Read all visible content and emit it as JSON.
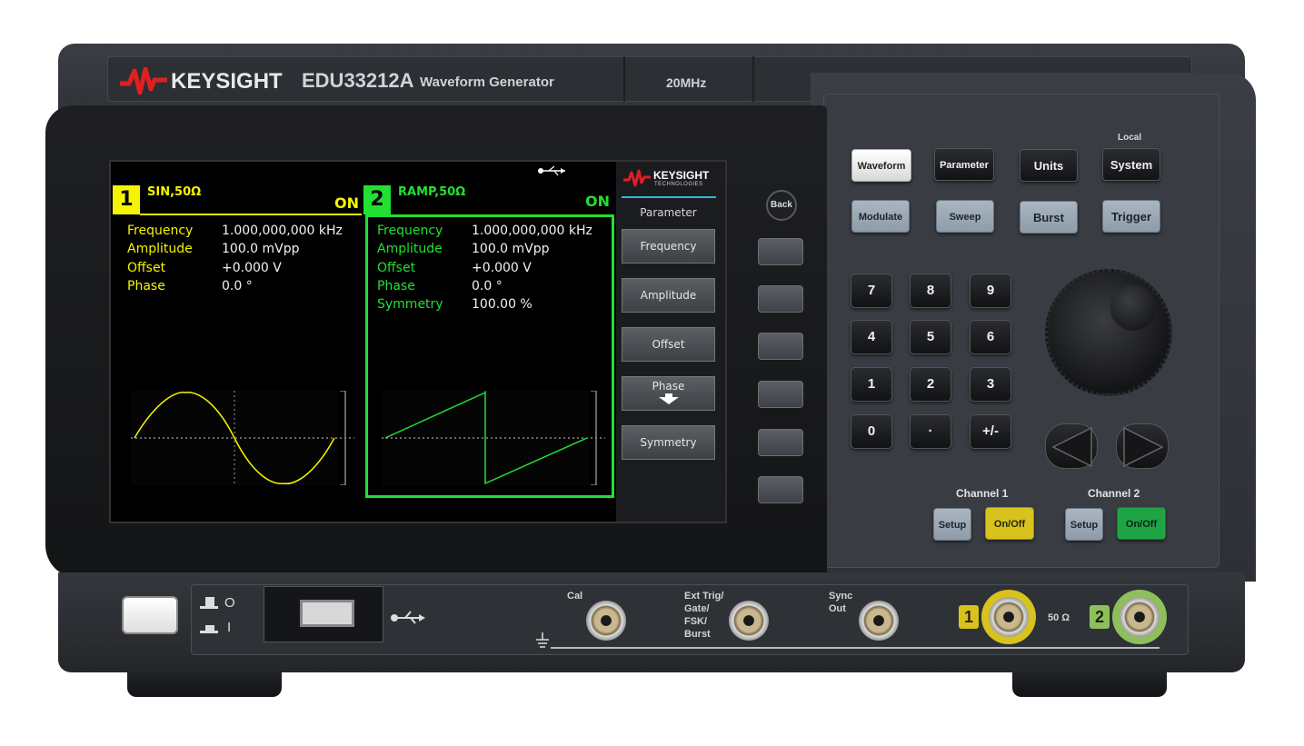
{
  "header": {
    "brand": "KEYSIGHT",
    "model": "EDU33212A",
    "product": "Waveform Generator",
    "bandwidth": "20MHz"
  },
  "screen": {
    "usb_icon": "usb-icon",
    "channel1": {
      "number": "1",
      "name": "SIN,50Ω",
      "state": "ON",
      "params": [
        {
          "label": "Frequency",
          "value": "1.000,000,000 kHz"
        },
        {
          "label": "Amplitude",
          "value": "100.0 mVpp"
        },
        {
          "label": "Offset",
          "value": "+0.000 V"
        },
        {
          "label": "Phase",
          "value": "0.0 °"
        }
      ],
      "color": "#f5f500"
    },
    "channel2": {
      "number": "2",
      "name": "RAMP,50Ω",
      "state": "ON",
      "params": [
        {
          "label": "Frequency",
          "value": "1.000,000,000 kHz"
        },
        {
          "label": "Amplitude",
          "value": "100.0 mVpp"
        },
        {
          "label": "Offset",
          "value": "+0.000 V"
        },
        {
          "label": "Phase",
          "value": "0.0 °"
        },
        {
          "label": "Symmetry",
          "value": "100.00 %"
        }
      ],
      "color": "#22e032"
    },
    "softkeys": {
      "brand": "KEYSIGHT",
      "brand_sub": "TECHNOLOGIES",
      "title": "Parameter",
      "items": [
        "Frequency",
        "Amplitude",
        "Offset",
        "Phase",
        "Symmetry"
      ]
    }
  },
  "controls": {
    "back": "Back",
    "local_label": "Local",
    "function_keys": [
      "Waveform",
      "Parameter",
      "Units",
      "System",
      "Modulate",
      "Sweep",
      "Burst",
      "Trigger"
    ],
    "numpad": [
      "7",
      "8",
      "9",
      "4",
      "5",
      "6",
      "1",
      "2",
      "3",
      "0",
      "·",
      "+/-"
    ],
    "channel1_label": "Channel 1",
    "channel2_label": "Channel 2",
    "setup": "Setup",
    "onoff": "On/Off",
    "ch1_onoff_color": "#d8c21d",
    "ch2_onoff_color": "#1fa445"
  },
  "front_panel": {
    "cal": "Cal",
    "ext_trig": [
      "Ext Trig/",
      "Gate/",
      "FSK/",
      "Burst"
    ],
    "sync_out": [
      "Sync",
      "Out"
    ],
    "impedance": "50 Ω",
    "out1": "1",
    "out2": "2",
    "power_on_symbol": "O",
    "power_off_symbol": "I"
  }
}
